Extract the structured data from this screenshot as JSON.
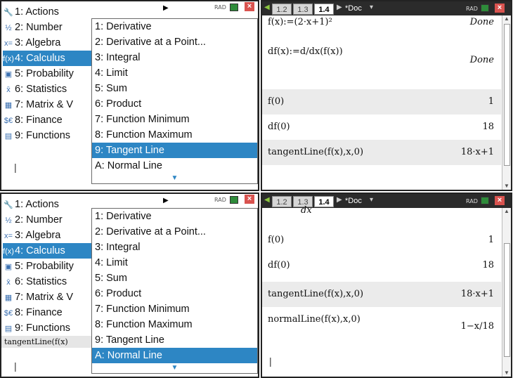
{
  "status": {
    "mode": "RAD"
  },
  "actions_menu": [
    {
      "key": "1",
      "label": "Actions",
      "icon": "tools-icon"
    },
    {
      "key": "2",
      "label": "Number",
      "icon": "number-icon"
    },
    {
      "key": "3",
      "label": "Algebra",
      "icon": "algebra-icon"
    },
    {
      "key": "4",
      "label": "Calculus",
      "icon": "calculus-icon"
    },
    {
      "key": "5",
      "label": "Probability",
      "icon": "dice-icon"
    },
    {
      "key": "6",
      "label": "Statistics",
      "icon": "statistics-icon"
    },
    {
      "key": "7",
      "label": "Matrix & V",
      "icon": "matrix-icon"
    },
    {
      "key": "8",
      "label": "Finance",
      "icon": "finance-icon"
    },
    {
      "key": "9",
      "label": "Functions",
      "icon": "functions-icon"
    }
  ],
  "calculus_submenu": [
    "1: Derivative",
    "2: Derivative at a Point...",
    "3: Integral",
    "4: Limit",
    "5: Sum",
    "6: Product",
    "7: Function Minimum",
    "8: Function Maximum",
    "9: Tangent Line",
    "A: Normal Line"
  ],
  "panel_top": {
    "selected_submenu": "9: Tangent Line",
    "tabs": [
      "1.2",
      "1.3",
      "1.4"
    ],
    "active_tab": "1.4",
    "doc_label": "*Doc",
    "rows": [
      {
        "expr": "f(x):=(2·x+1)²",
        "result": "Done"
      },
      {
        "expr": "df(x):=d/dx(f(x))",
        "result": "Done"
      },
      {
        "expr": "f(0)",
        "result": "1"
      },
      {
        "expr": "df(0)",
        "result": "18"
      },
      {
        "expr": "tangentLine(f(x),x,0)",
        "result": "18·x+1"
      }
    ]
  },
  "panel_bottom": {
    "selected_submenu": "A: Normal Line",
    "entry_line": "tangentLine(f(x)",
    "tabs": [
      "1.2",
      "1.3",
      "1.4"
    ],
    "active_tab": "1.4",
    "doc_label": "*Doc",
    "rows": [
      {
        "expr": "f(0)",
        "result": "1"
      },
      {
        "expr": "df(0)",
        "result": "18"
      },
      {
        "expr": "tangentLine(f(x),x,0)",
        "result": "18·x+1"
      },
      {
        "expr": "normalLine(f(x),x,0)",
        "result": "1−x/18"
      }
    ]
  },
  "colors": {
    "highlight": "#2d86c4",
    "tabbar": "#2b2b2b",
    "close": "#d9534f",
    "battery": "#2e8b3a"
  }
}
